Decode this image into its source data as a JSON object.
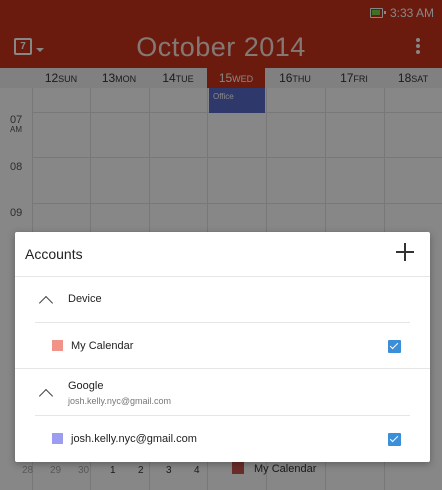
{
  "status_bar": {
    "time": "3:33 AM"
  },
  "header": {
    "month_title": "October 2014",
    "calendar_icon_glyph": "7"
  },
  "week": [
    {
      "num": "12",
      "name": "SUN"
    },
    {
      "num": "13",
      "name": "MON"
    },
    {
      "num": "14",
      "name": "TUE"
    },
    {
      "num": "15",
      "name": "WED"
    },
    {
      "num": "16",
      "name": "THU"
    },
    {
      "num": "17",
      "name": "FRI"
    },
    {
      "num": "18",
      "name": "SAT"
    }
  ],
  "hours": [
    {
      "label": "07",
      "ampm": "AM"
    },
    {
      "label": "08",
      "ampm": ""
    },
    {
      "label": "09",
      "ampm": ""
    }
  ],
  "event": {
    "title": "Office"
  },
  "mini_month": [
    "28",
    "29",
    "30",
    "1",
    "2",
    "3",
    "4"
  ],
  "bottom_calendar": "My Calendar",
  "dialog": {
    "title": "Accounts",
    "sections": [
      {
        "name": "Device",
        "sub": "",
        "calendars": [
          {
            "name": "My Calendar",
            "color": "#f2938a",
            "checked": true
          }
        ]
      },
      {
        "name": "Google",
        "sub": "josh.kelly.nyc@gmail.com",
        "calendars": [
          {
            "name": "josh.kelly.nyc@gmail.com",
            "color": "#9c9cf0",
            "checked": true
          }
        ]
      }
    ]
  },
  "colors": {
    "accent": "#c9331a",
    "checkbox": "#3b8fd8"
  }
}
